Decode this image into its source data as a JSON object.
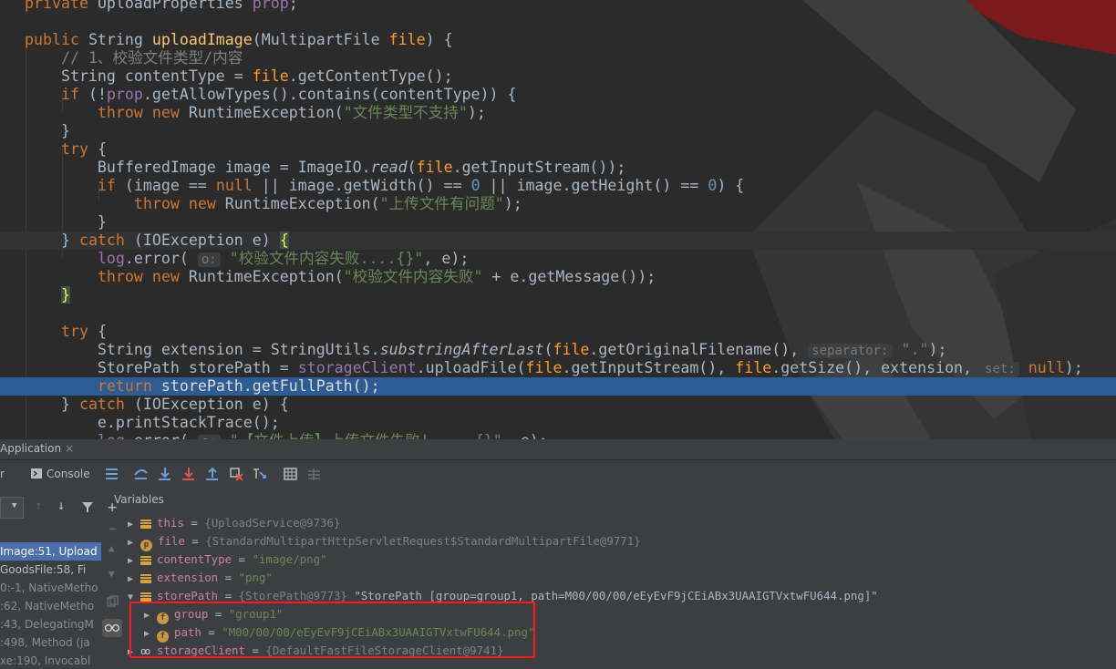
{
  "editor": {
    "lines": [
      {
        "tokens": [
          [
            "kw",
            "private "
          ],
          [
            "",
            "UploadProperties "
          ],
          [
            "fld",
            "prop"
          ],
          [
            "",
            ";"
          ]
        ]
      },
      {
        "tokens": []
      },
      {
        "tokens": [
          [
            "kw",
            "public "
          ],
          [
            "",
            "String "
          ],
          [
            "fn",
            "uploadImage"
          ],
          [
            "",
            "(MultipartFile "
          ],
          [
            "prm",
            "file"
          ],
          [
            "",
            ") {"
          ]
        ]
      },
      {
        "tokens": [
          [
            "",
            "    "
          ],
          [
            "cmt",
            "// 1、校验文件类型/内容"
          ]
        ]
      },
      {
        "tokens": [
          [
            "",
            "    String contentType = "
          ],
          [
            "prm",
            "file"
          ],
          [
            "",
            ".getContentType();"
          ]
        ]
      },
      {
        "tokens": [
          [
            "",
            "    "
          ],
          [
            "kw",
            "if "
          ],
          [
            "",
            "(!"
          ],
          [
            "fld",
            "prop"
          ],
          [
            "",
            ".getAllowTypes().contains(contentType)) {"
          ]
        ]
      },
      {
        "tokens": [
          [
            "",
            "        "
          ],
          [
            "kw",
            "throw new "
          ],
          [
            "",
            "RuntimeException("
          ],
          [
            "str",
            "\"文件类型不支持\""
          ],
          [
            "",
            ");"
          ]
        ]
      },
      {
        "tokens": [
          [
            "",
            "    }"
          ]
        ]
      },
      {
        "tokens": [
          [
            "",
            "    "
          ],
          [
            "kw",
            "try "
          ],
          [
            "",
            "{"
          ]
        ]
      },
      {
        "tokens": [
          [
            "",
            "        BufferedImage image = ImageIO."
          ],
          [
            "ital",
            "read"
          ],
          [
            "",
            "("
          ],
          [
            "prm",
            "file"
          ],
          [
            "",
            ".getInputStream());"
          ]
        ]
      },
      {
        "tokens": [
          [
            "",
            "        "
          ],
          [
            "kw",
            "if "
          ],
          [
            "",
            "(image == "
          ],
          [
            "kw",
            "null "
          ],
          [
            "",
            "|| image.getWidth() == "
          ],
          [
            "num",
            "0"
          ],
          [
            "",
            " || image.getHeight() == "
          ],
          [
            "num",
            "0"
          ],
          [
            "",
            ") {"
          ]
        ]
      },
      {
        "tokens": [
          [
            "",
            "            "
          ],
          [
            "kw",
            "throw new "
          ],
          [
            "",
            "RuntimeException("
          ],
          [
            "str",
            "\"上传文件有问题\""
          ],
          [
            "",
            ");"
          ]
        ]
      },
      {
        "tokens": [
          [
            "",
            "        }"
          ]
        ]
      },
      {
        "tokens": [
          [
            "",
            "    } "
          ],
          [
            "kw",
            "catch "
          ],
          [
            "",
            "(IOException e) "
          ],
          [
            "brace-hl",
            "{"
          ]
        ]
      },
      {
        "tokens": [
          [
            "",
            "        "
          ],
          [
            "fld",
            "log"
          ],
          [
            "",
            ".error( "
          ],
          [
            "hint",
            "o:"
          ],
          [
            "",
            ""
          ],
          [
            "str",
            " \"校验文件内容失败....{}\""
          ],
          [
            "",
            ", e);"
          ]
        ]
      },
      {
        "tokens": [
          [
            "",
            "        "
          ],
          [
            "kw",
            "throw new "
          ],
          [
            "",
            "RuntimeException("
          ],
          [
            "str",
            "\"校验文件内容失败\""
          ],
          [
            "",
            " + e.getMessage());"
          ]
        ]
      },
      {
        "tokens": [
          [
            "",
            "    "
          ],
          [
            "brace-hl",
            "}"
          ]
        ]
      },
      {
        "tokens": []
      },
      {
        "tokens": [
          [
            "",
            "    "
          ],
          [
            "kw",
            "try "
          ],
          [
            "",
            "{"
          ]
        ]
      },
      {
        "tokens": [
          [
            "",
            "        String extension = StringUtils."
          ],
          [
            "ital",
            "substringAfterLast"
          ],
          [
            "",
            "("
          ],
          [
            "prm",
            "file"
          ],
          [
            "",
            ".getOriginalFilename(), "
          ],
          [
            "hint",
            "separator:"
          ],
          [
            "",
            ""
          ],
          [
            "str",
            " \".\""
          ],
          [
            "",
            ");"
          ]
        ]
      },
      {
        "tokens": [
          [
            "",
            "        StorePath storePath = "
          ],
          [
            "fld",
            "storageClient"
          ],
          [
            "",
            ".uploadFile("
          ],
          [
            "prm",
            "file"
          ],
          [
            "",
            ".getInputStream(), "
          ],
          [
            "prm",
            "file"
          ],
          [
            "",
            ".getSize(), extension, "
          ],
          [
            "hint",
            "set:"
          ],
          [
            "",
            ""
          ],
          [
            "kw",
            " null"
          ],
          [
            "",
            ");"
          ]
        ]
      },
      {
        "tokens": [
          [
            "",
            "        "
          ],
          [
            "kw",
            "return "
          ],
          [
            "",
            "storePath.getFullPath();"
          ]
        ]
      },
      {
        "tokens": [
          [
            "",
            "    } "
          ],
          [
            "kw",
            "catch "
          ],
          [
            "",
            "(IOException e) {"
          ]
        ]
      },
      {
        "tokens": [
          [
            "",
            "        e.printStackTrace();"
          ]
        ]
      },
      {
        "tokens": [
          [
            "",
            "        "
          ],
          [
            "fld",
            "log"
          ],
          [
            "",
            ".error( "
          ],
          [
            "hint",
            "o:"
          ],
          [
            "",
            ""
          ],
          [
            "str",
            " \"【文件上传】上传文件失败! ....{}\""
          ],
          [
            "",
            ", e);"
          ]
        ]
      }
    ]
  },
  "debug": {
    "tab_label": "Application",
    "tab_close": "×",
    "subtab_left": "r",
    "console_label": "Console",
    "variables_title": "Variables",
    "frames": [
      {
        "text": "Image:51, Upload"
      },
      {
        "text": "GoodsFile:58, Fi"
      },
      {
        "text": "0:-1, NativeMetho"
      },
      {
        "text": ":62, NativeMetho"
      },
      {
        "text": ":43, DelegatingM"
      },
      {
        "text": ":498, Method (ja"
      },
      {
        "text": "xe:190, Invocabl"
      }
    ],
    "variables": [
      {
        "expand": "▶",
        "icon": "field",
        "name": "this",
        "value": " = ",
        "ref": "{UploadService@9736}",
        "extra": ""
      },
      {
        "expand": "▶",
        "icon": "p",
        "name": "file",
        "value": " = ",
        "ref": "{StandardMultipartHttpServletRequest$StandardMultipartFile@9771}",
        "extra": ""
      },
      {
        "expand": "▶",
        "icon": "field",
        "name": "contentType",
        "value": " = ",
        "ref": "",
        "extra": "\"image/png\""
      },
      {
        "expand": "▶",
        "icon": "field",
        "name": "extension",
        "value": " = ",
        "ref": "",
        "extra": "\"png\""
      },
      {
        "expand": "▼",
        "icon": "field",
        "name": "storePath",
        "value": " = ",
        "ref": "{StorePath@9773} ",
        "extra": "\"StorePath [group=group1, path=M00/00/00/eEyEvF9jCEiABx3UAAIGTVxtwFU644.png]\""
      },
      {
        "expand": "▶",
        "icon": "f",
        "name": "group",
        "value": " = ",
        "ref": "",
        "extra": "\"group1\"",
        "indent": true
      },
      {
        "expand": "▶",
        "icon": "f",
        "name": "path",
        "value": " = ",
        "ref": "",
        "extra": "\"M00/00/00/eEyEvF9jCEiABx3UAAIGTVxtwFU644.png\"",
        "indent": true
      },
      {
        "expand": "▶",
        "icon": "oo",
        "name": "storageClient",
        "value": " = ",
        "ref": "{DefaultFastFileStorageClient@9741}",
        "extra": ""
      }
    ]
  }
}
